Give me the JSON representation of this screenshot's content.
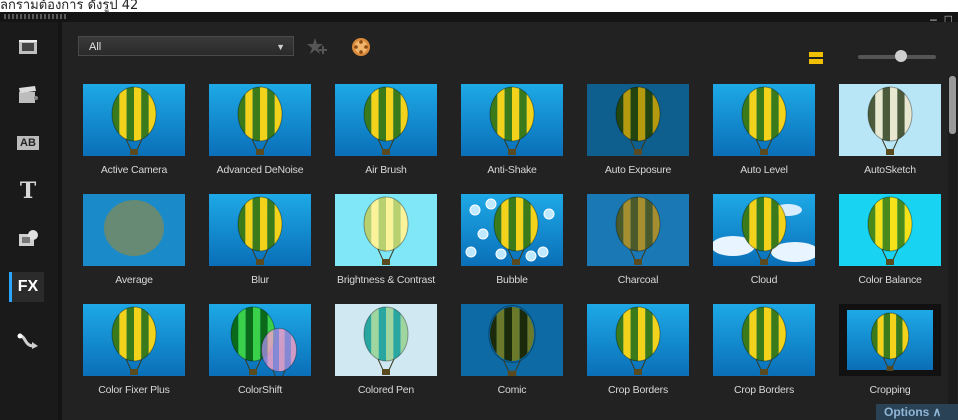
{
  "caption": "ลกรามต้องการ ดังรูป 42",
  "window": {
    "minimize_label": "–",
    "maximize_label": "□"
  },
  "sidebar": {
    "items": [
      {
        "name": "media",
        "icon": "film-library-icon"
      },
      {
        "name": "instant-project",
        "icon": "clapper-icon"
      },
      {
        "name": "transition",
        "icon": "ab-transition-icon",
        "label": "AB"
      },
      {
        "name": "title",
        "icon": "title-icon",
        "label": "T"
      },
      {
        "name": "graphic",
        "icon": "graphic-icon"
      },
      {
        "name": "filter",
        "icon": "fx-icon",
        "label": "FX",
        "active": true
      },
      {
        "name": "path",
        "icon": "path-icon"
      }
    ]
  },
  "toolbar": {
    "filter_value": "All",
    "zoom_level": 0.55
  },
  "tiles": [
    {
      "label": "Active Camera",
      "variant": "normal"
    },
    {
      "label": "Advanced DeNoise",
      "variant": "normal"
    },
    {
      "label": "Air Brush",
      "variant": "normal"
    },
    {
      "label": "Anti-Shake",
      "variant": "normal"
    },
    {
      "label": "Auto Exposure",
      "variant": "dark"
    },
    {
      "label": "Auto Level",
      "variant": "normal"
    },
    {
      "label": "AutoSketch",
      "variant": "sketch"
    },
    {
      "label": "Average",
      "variant": "blurry"
    },
    {
      "label": "Blur",
      "variant": "normal"
    },
    {
      "label": "Brightness & Contrast",
      "variant": "bright"
    },
    {
      "label": "Bubble",
      "variant": "bubble"
    },
    {
      "label": "Charcoal",
      "variant": "charcoal"
    },
    {
      "label": "Cloud",
      "variant": "cloud"
    },
    {
      "label": "Color Balance",
      "variant": "cyan"
    },
    {
      "label": "Color Fixer Plus",
      "variant": "normal"
    },
    {
      "label": "ColorShift",
      "variant": "shift"
    },
    {
      "label": "Colored Pen",
      "variant": "pen"
    },
    {
      "label": "Comic",
      "variant": "comic"
    },
    {
      "label": "Crop Borders",
      "variant": "normal"
    },
    {
      "label": "Crop Borders",
      "variant": "normal"
    },
    {
      "label": "Cropping",
      "variant": "cropping"
    }
  ],
  "options_label": "Options ∧"
}
